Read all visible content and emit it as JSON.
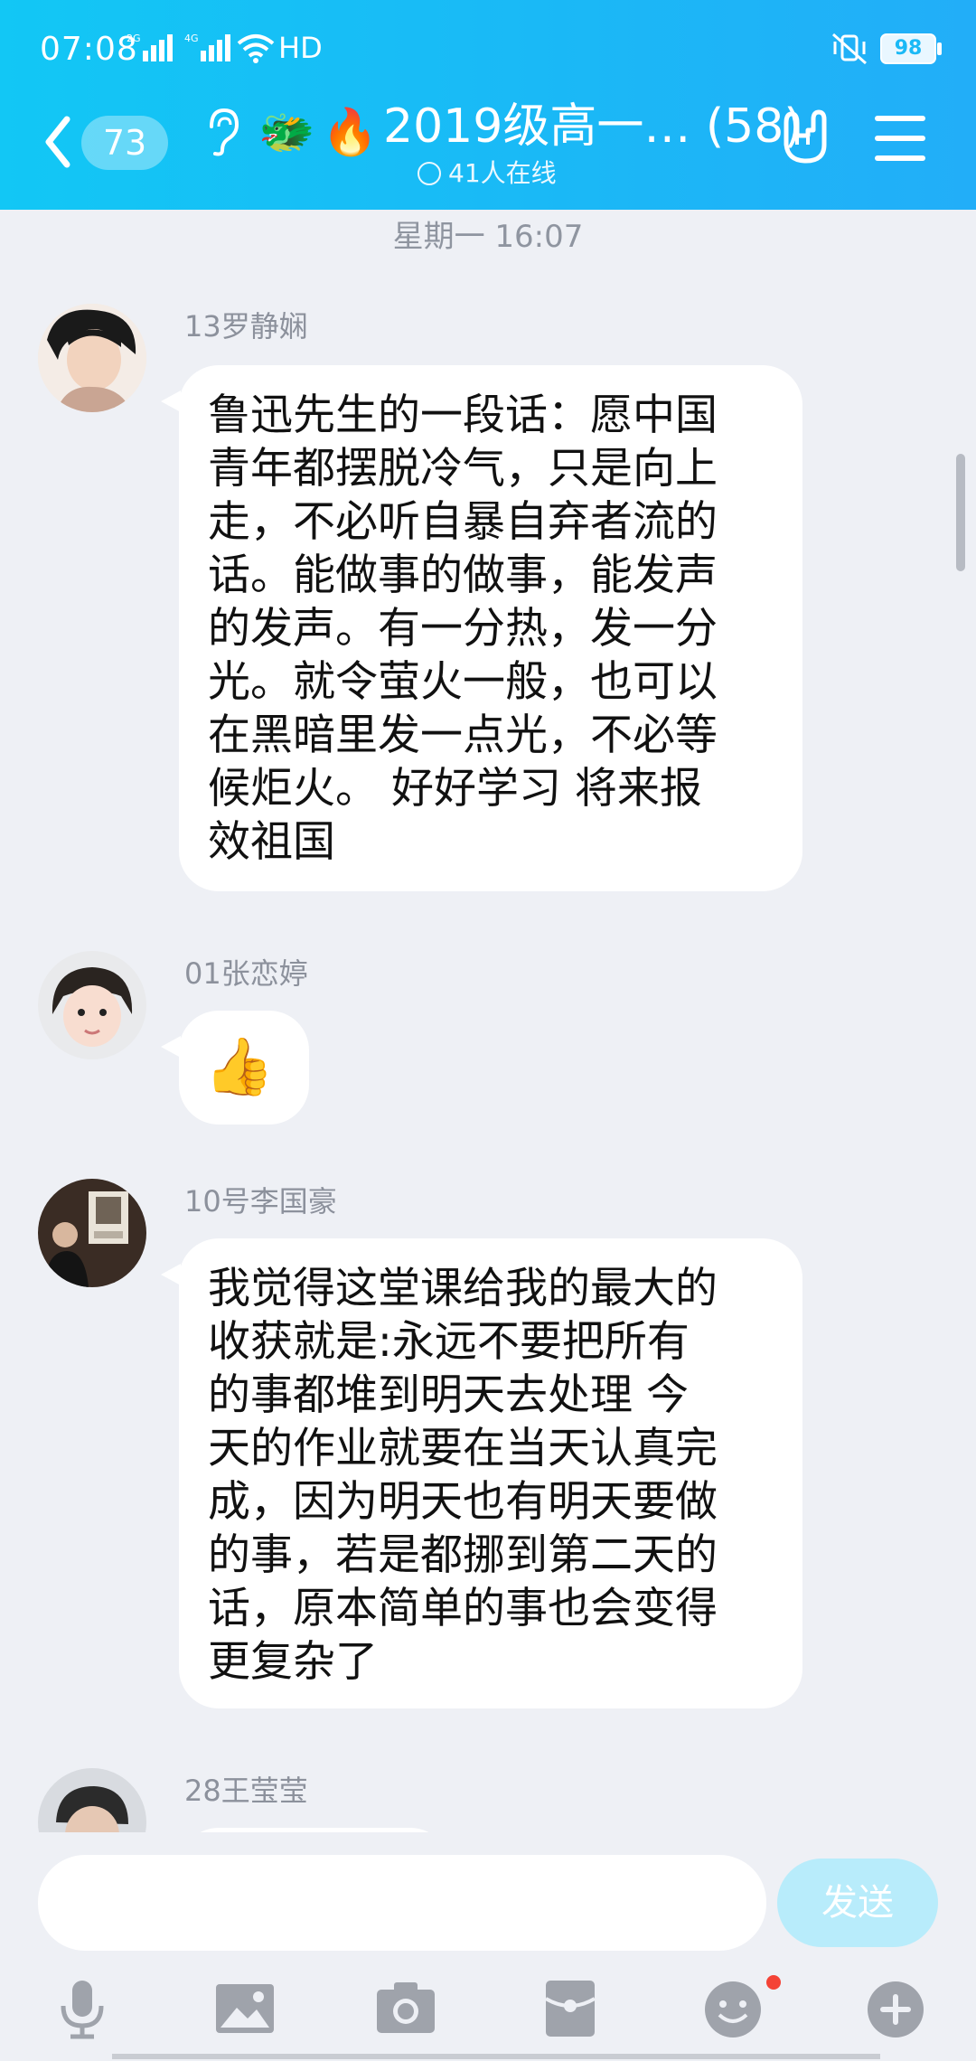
{
  "status_bar": {
    "time": "07:08",
    "network_1": "2G",
    "network_2": "4G",
    "hd": "HD",
    "battery": "98"
  },
  "header": {
    "unread_count": "73",
    "title": "2019级高一… (58)",
    "online": "41人在线",
    "emoji_1": "🐲",
    "emoji_2": "🔥"
  },
  "chat": {
    "timestamp": "星期一 16:07",
    "messages": [
      {
        "sender": "13罗静娴",
        "text": "鲁迅先生的一段话：愿中国\n青年都摆脱冷气，只是向上\n走，不必听自暴自弃者流的\n话。能做事的做事，能发声\n的发声。有一分热，发一分\n光。就令萤火一般，也可以\n在黑暗里发一点光，不必等\n候炬火。 好好学习 将来报\n效祖国"
      },
      {
        "sender": "01张恋婷",
        "text": "👍"
      },
      {
        "sender": "10号李国豪",
        "text": "我觉得这堂课给我的最大的\n收获就是:永远不要把所有\n的事都堆到明天去处理 今\n天的作业就要在当天认真完\n成，因为明天也有明天要做\n的事，若是都挪到第二天的\n话，原本简单的事也会变得\n更复杂了"
      },
      {
        "sender": "28王莹莹",
        "text": ""
      }
    ]
  },
  "input": {
    "placeholder": "",
    "send_label": "发送"
  },
  "colors": {
    "header_start": "#12c7f5",
    "header_end": "#22aef8",
    "background": "#eef0f5",
    "send_button": "#b8ecfb"
  }
}
